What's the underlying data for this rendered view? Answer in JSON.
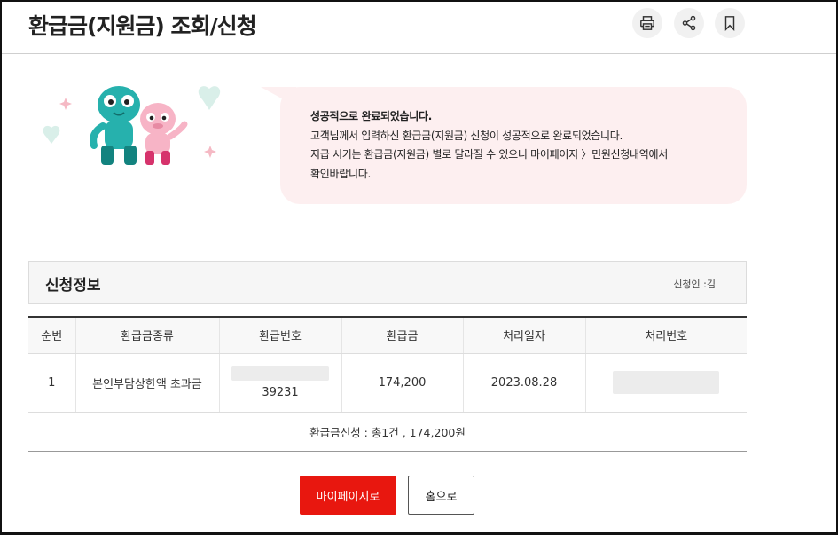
{
  "page": {
    "title": "환급금(지원금) 조회/신청"
  },
  "toolbar": {
    "icons": [
      "print-icon",
      "share-icon",
      "bookmark-icon"
    ]
  },
  "notice": {
    "headline": "성공적으로 완료되었습니다.",
    "line1": "고객님께서 입력하신 환급금(지원금) 신청이 성공적으로 완료되었습니다.",
    "line2": "지급 시기는 환급금(지원금) 별로 달라질 수 있으니 마이페이지 〉민원신청내역에서",
    "line3": "확인바랍니다.",
    "bubble_color": "#fdeff0"
  },
  "info": {
    "title": "신청정보",
    "applicant": "신청인 :김"
  },
  "table": {
    "headers": [
      "순번",
      "환급금종류",
      "환급번호",
      "환급금",
      "처리일자",
      "처리번호"
    ],
    "rows": [
      {
        "no": "1",
        "type": "본인부담상한액 초과금",
        "refund_no_visible": "39231",
        "amount": "174,200",
        "date": "2023.08.28"
      }
    ],
    "summary": "환급금신청 : 총1건 , 174,200원"
  },
  "buttons": {
    "mypage": "마이페이지로",
    "home": "홈으로",
    "primary_color": "#e8170f"
  }
}
